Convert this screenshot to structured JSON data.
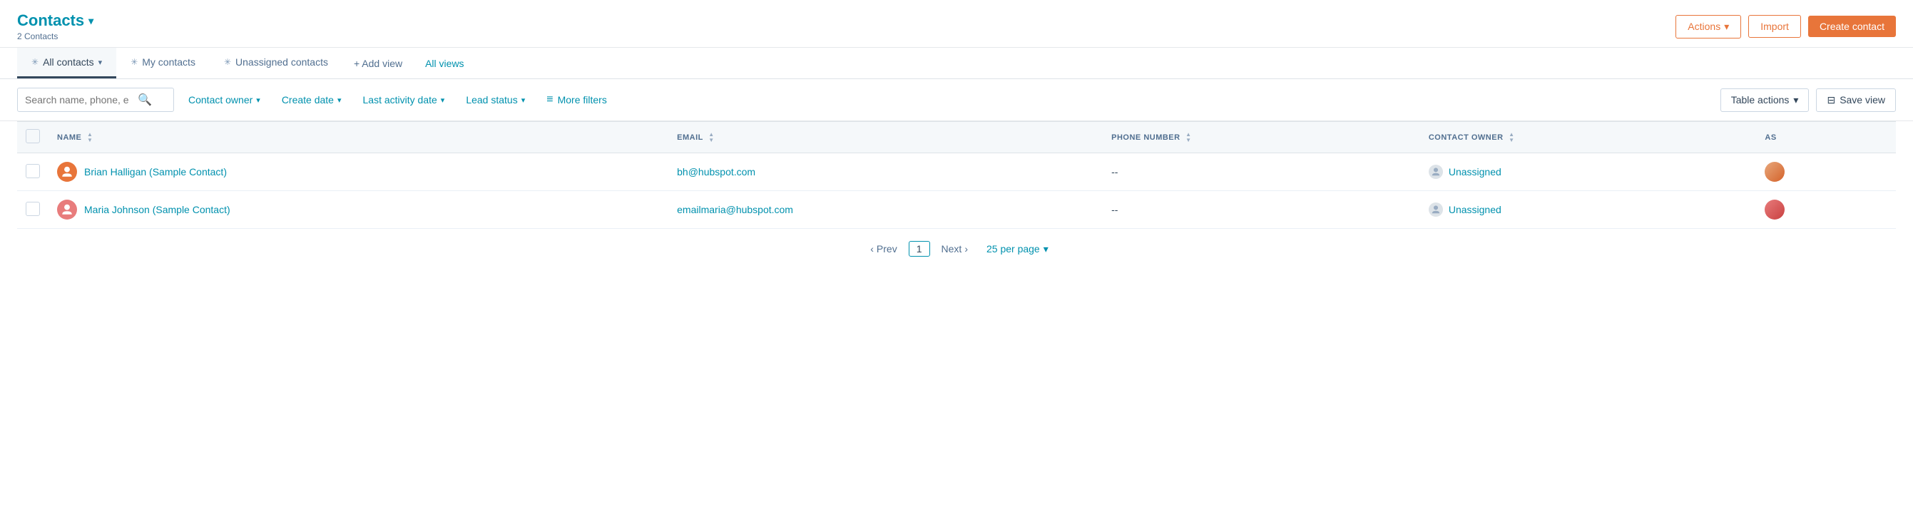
{
  "header": {
    "title": "Contacts",
    "subtitle": "2 Contacts",
    "actions_button": "Actions",
    "import_button": "Import",
    "create_contact_button": "Create contact"
  },
  "tabs": [
    {
      "id": "all-contacts",
      "label": "All contacts",
      "active": true,
      "icon": "pin"
    },
    {
      "id": "my-contacts",
      "label": "My contacts",
      "active": false,
      "icon": "pin"
    },
    {
      "id": "unassigned-contacts",
      "label": "Unassigned contacts",
      "active": false,
      "icon": "pin"
    }
  ],
  "add_view": {
    "label": "+ Add view"
  },
  "all_views": {
    "label": "All views"
  },
  "filters": {
    "search_placeholder": "Search name, phone, e",
    "contact_owner_label": "Contact owner",
    "create_date_label": "Create date",
    "last_activity_date_label": "Last activity date",
    "lead_status_label": "Lead status",
    "more_filters_label": "More filters",
    "table_actions_label": "Table actions",
    "save_view_label": "Save view"
  },
  "table": {
    "columns": [
      {
        "id": "name",
        "label": "NAME",
        "sortable": true
      },
      {
        "id": "email",
        "label": "EMAIL",
        "sortable": true
      },
      {
        "id": "phone",
        "label": "PHONE NUMBER",
        "sortable": true
      },
      {
        "id": "contact_owner",
        "label": "CONTACT OWNER",
        "sortable": true
      },
      {
        "id": "assigned",
        "label": "AS",
        "sortable": false
      }
    ],
    "rows": [
      {
        "id": "row-1",
        "name": "Brian Halligan (Sample Contact)",
        "email": "bh@hubspot.com",
        "phone": "--",
        "contact_owner": "Unassigned",
        "avatar_color": "#e8753a",
        "avatar_initials": "🔶"
      },
      {
        "id": "row-2",
        "name": "Maria Johnson (Sample Contact)",
        "email": "emailmaria@hubspot.com",
        "phone": "--",
        "contact_owner": "Unassigned",
        "avatar_color": "#e87c7c",
        "avatar_initials": "🔶"
      }
    ]
  },
  "pagination": {
    "prev_label": "Prev",
    "next_label": "Next",
    "current_page": "1",
    "per_page_label": "25 per page"
  },
  "icons": {
    "chevron_down": "▾",
    "chevron_left": "‹",
    "chevron_right": "›",
    "search": "🔍",
    "pin": "✳",
    "sort_asc": "▲",
    "sort_desc": "▼",
    "filters_icon": "≡",
    "save_icon": "⊟",
    "user_placeholder": "👤"
  }
}
